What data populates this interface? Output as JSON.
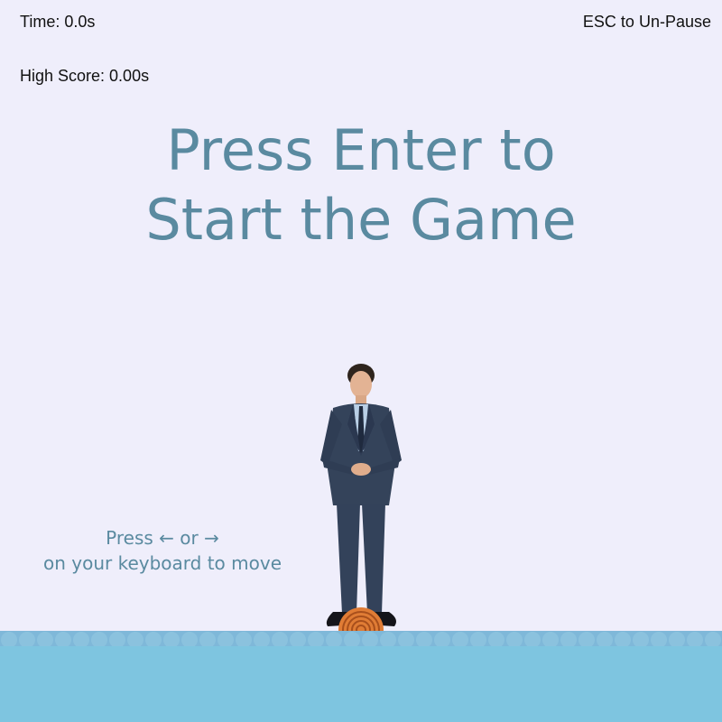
{
  "hud": {
    "time": "Time: 0.0s",
    "high_score": "High Score: 0.00s",
    "esc_hint": "ESC to Un-Pause"
  },
  "title": {
    "line1": "Press Enter to",
    "line2": "Start the Game"
  },
  "instructions": {
    "line1": "Press ← or →",
    "line2": "on your keyboard to move"
  },
  "colors": {
    "background": "#efeefb",
    "title_text": "#5a8aa0",
    "water": "#7ec5e0",
    "water_top": "#7fb8d9",
    "log": "#e07c35"
  },
  "sprites": {
    "player": "man-in-suit-sprite",
    "platform": "wooden-log-icon"
  }
}
